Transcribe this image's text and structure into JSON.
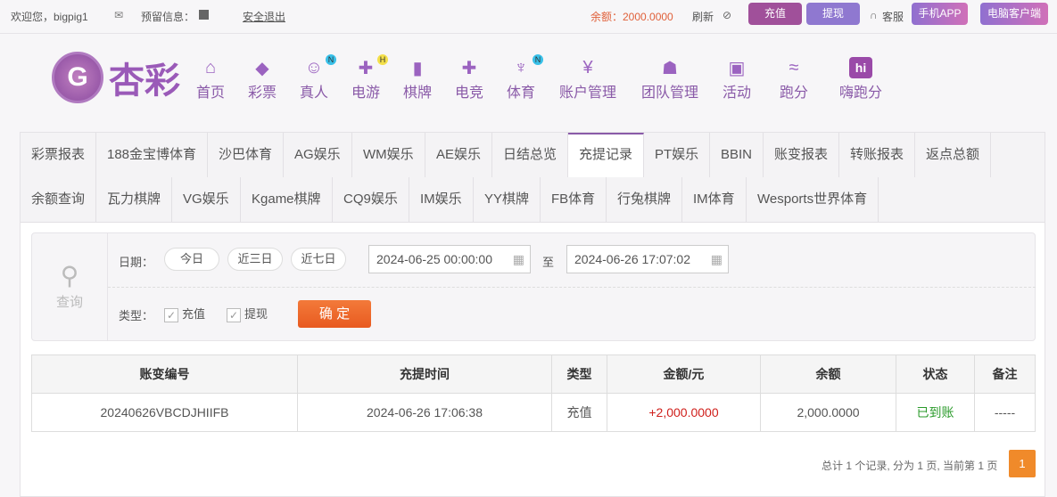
{
  "topbar": {
    "welcome": "欢迎您，bigpig1",
    "reserved_info": "预留信息：",
    "logout": "安全退出",
    "balance": "余额：2000.0000",
    "refresh": "刷新",
    "deposit": "充值",
    "withdraw": "提现",
    "service": "客服",
    "mobile_app": "手机APP",
    "pc_client": "电脑客户端"
  },
  "brand": {
    "logo_text": "杏彩"
  },
  "nav": [
    {
      "label": "首页",
      "icon": "home-icon"
    },
    {
      "label": "彩票",
      "icon": "ticket-icon"
    },
    {
      "label": "真人",
      "icon": "woman-icon",
      "badge": "N"
    },
    {
      "label": "电游",
      "icon": "gamepad-icon",
      "badge": "H"
    },
    {
      "label": "棋牌",
      "icon": "cards-icon"
    },
    {
      "label": "电竞",
      "icon": "gamepad-icon"
    },
    {
      "label": "体育",
      "icon": "trophy-icon",
      "badge": "N"
    },
    {
      "label": "账户管理",
      "icon": "yen-icon"
    },
    {
      "label": "团队管理",
      "icon": "team-icon"
    },
    {
      "label": "活动",
      "icon": "gift-icon"
    },
    {
      "label": "跑分",
      "icon": "rhino-icon"
    },
    {
      "label": "嗨跑分",
      "icon": "hi-icon"
    }
  ],
  "tabs_row1": [
    "彩票报表",
    "188金宝博体育",
    "沙巴体育",
    "AG娱乐",
    "WM娱乐",
    "AE娱乐",
    "日结总览",
    "充提记录",
    "PT娱乐",
    "BBIN",
    "账变报表",
    "转账报表",
    "返点总额"
  ],
  "tabs_row2": [
    "余额查询",
    "瓦力棋牌",
    "VG娱乐",
    "Kgame棋牌",
    "CQ9娱乐",
    "IM娱乐",
    "YY棋牌",
    "FB体育",
    "行兔棋牌",
    "IM体育",
    "Wesports世界体育"
  ],
  "active_tab": "充提记录",
  "filter": {
    "search_label": "查询",
    "date_label": "日期：",
    "today": "今日",
    "three_days": "近三日",
    "seven_days": "近七日",
    "start": "2024-06-25 00:00:00",
    "to": "至",
    "end": "2024-06-26 17:07:02",
    "type_label": "类型：",
    "type_deposit": "充值",
    "type_withdraw": "提现",
    "confirm": "确 定"
  },
  "table": {
    "headers": [
      "账变编号",
      "充提时间",
      "类型",
      "金额/元",
      "余额",
      "状态",
      "备注"
    ],
    "rows": [
      [
        "20240626VBCDJHIIFB",
        "2024-06-26 17:06:38",
        "充值",
        "+2,000.0000",
        "2,000.0000",
        "已到账",
        "-----"
      ]
    ]
  },
  "pagination": {
    "summary": "总计 1 个记录, 分为 1 页, 当前第 1 页",
    "current": "1"
  },
  "colors": {
    "accent": "#8a5aa8",
    "deposit": "#a0509a",
    "withdraw": "#8f78d0",
    "confirm": "#f06a2a",
    "amount": "#d0201c",
    "status": "#2a9a2a"
  }
}
